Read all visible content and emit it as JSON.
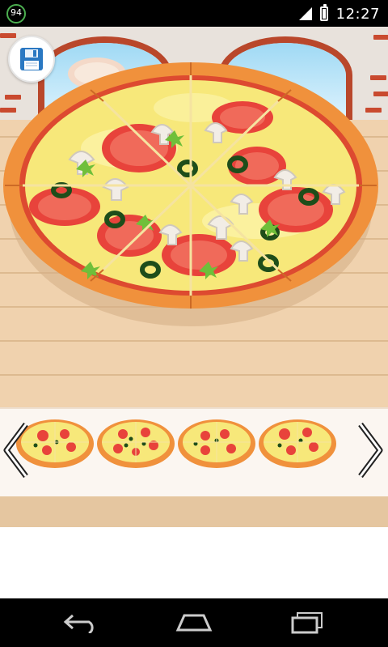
{
  "status_bar": {
    "notification_badge": "94",
    "time": "12:27"
  },
  "toolbar": {
    "save_icon": "floppy-disk-icon"
  },
  "pizza_selector": {
    "prev_icon": "chevron-left-icon",
    "next_icon": "chevron-right-icon",
    "thumbnail_count": 4
  },
  "nav_bar": {
    "back_icon": "back-arrow-icon",
    "home_icon": "home-icon",
    "recents_icon": "recent-apps-icon"
  },
  "colors": {
    "crust": "#f0913c",
    "cheese": "#f7e87a",
    "tomato": "#e8433b",
    "olive": "#1e4d1a",
    "wood": "#f0d2ae",
    "brick": "#c94a2f"
  }
}
